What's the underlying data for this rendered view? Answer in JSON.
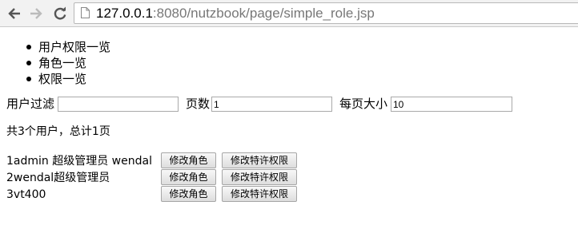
{
  "browser": {
    "url_host": "127.0.0.1",
    "url_rest": ":8080/nutzbook/page/simple_role.jsp"
  },
  "nav": {
    "items": [
      {
        "label": "用户权限一览"
      },
      {
        "label": "角色一览"
      },
      {
        "label": "权限一览"
      }
    ]
  },
  "filter": {
    "user_filter_label": "用户过滤",
    "user_filter_value": "",
    "page_label": "页数",
    "page_value": "1",
    "page_size_label": "每页大小",
    "page_size_value": "10"
  },
  "summary": "共3个用户，总计1页",
  "users": [
    {
      "text": "1admin 超级管理员 wendal",
      "edit_role_label": "修改角色",
      "edit_perm_label": "修改特许权限"
    },
    {
      "text": "2wendal超级管理员",
      "edit_role_label": "修改角色",
      "edit_perm_label": "修改特许权限"
    },
    {
      "text": "3vt400",
      "edit_role_label": "修改角色",
      "edit_perm_label": "修改特许权限"
    }
  ],
  "icons": {
    "back": "back-arrow-icon",
    "forward": "forward-arrow-icon",
    "reload": "reload-icon",
    "page": "page-icon"
  },
  "colors": {
    "toolbar_bg": "#f2f2f2",
    "url_host": "#000000",
    "url_rest": "#777777"
  }
}
